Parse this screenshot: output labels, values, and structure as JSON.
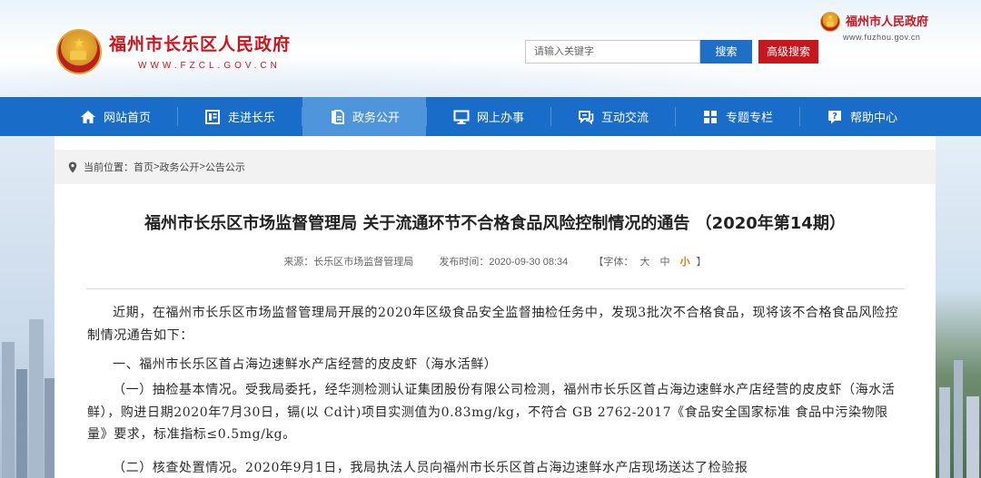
{
  "header": {
    "site_title": "福州市长乐区人民政府",
    "site_url": "WWW.FZCL.GOV.CN",
    "corner_title": "福州市人民政府",
    "corner_url": "www.fuzhou.gov.cn",
    "search": {
      "placeholder": "请输入关键字",
      "button_label": "搜索",
      "advanced_label": "高级搜索"
    },
    "colors": {
      "brand_red": "#c8161d",
      "nav_blue": "#1a6cc9",
      "nav_active": "#4f95db"
    }
  },
  "nav": {
    "items": [
      {
        "label": "网站首页",
        "icon": "home-icon"
      },
      {
        "label": "走进长乐",
        "icon": "book-icon"
      },
      {
        "label": "政务公开",
        "icon": "document-icon",
        "active": true
      },
      {
        "label": "网上办事",
        "icon": "monitor-icon"
      },
      {
        "label": "互动交流",
        "icon": "chat-icon"
      },
      {
        "label": "专题专栏",
        "icon": "grid-icon"
      },
      {
        "label": "帮助中心",
        "icon": "help-icon"
      }
    ]
  },
  "breadcrumb": {
    "prefix": "当前位置：",
    "items": [
      "首页",
      "政务公开",
      "公告公示"
    ],
    "separator": " > "
  },
  "article": {
    "title": "福州市长乐区市场监督管理局 关于流通环节不合格食品风险控制情况的通告 （2020年第14期）",
    "source": "来源：长乐区市场监督管理局",
    "published": "发布时间：2020-09-30 08:34",
    "font_size_label": "【字体：",
    "font_sizes": [
      "大",
      "中",
      "小"
    ],
    "font_size_selected": "小",
    "font_size_close": "】",
    "paragraphs": [
      "近期，在福州市长乐区市场监督管理局开展的2020年区级食品安全监督抽检任务中，发现3批次不合格食品，现将该不合格食品风险控制情况通告如下：",
      "一、福州市长乐区首占海边速鲜水产店经营的皮皮虾（海水活鲜）",
      "（一）抽检基本情况。受我局委托，经华测检测认证集团股份有限公司检测，福州市长乐区首占海边速鲜水产店经营的皮皮虾（海水活鲜），购进日期2020年7月30日，镉(以 Cd计)项目实测值为0.83mg/kg，不符合 GB 2762-2017《食品安全国家标准 食品中污染物限量》要求，标准指标≤0.5mg/kg。",
      "（二）核查处置情况。2020年9月1日，我局执法人员向福州市长乐区首占海边速鲜水产店现场送达了检验报"
    ]
  }
}
